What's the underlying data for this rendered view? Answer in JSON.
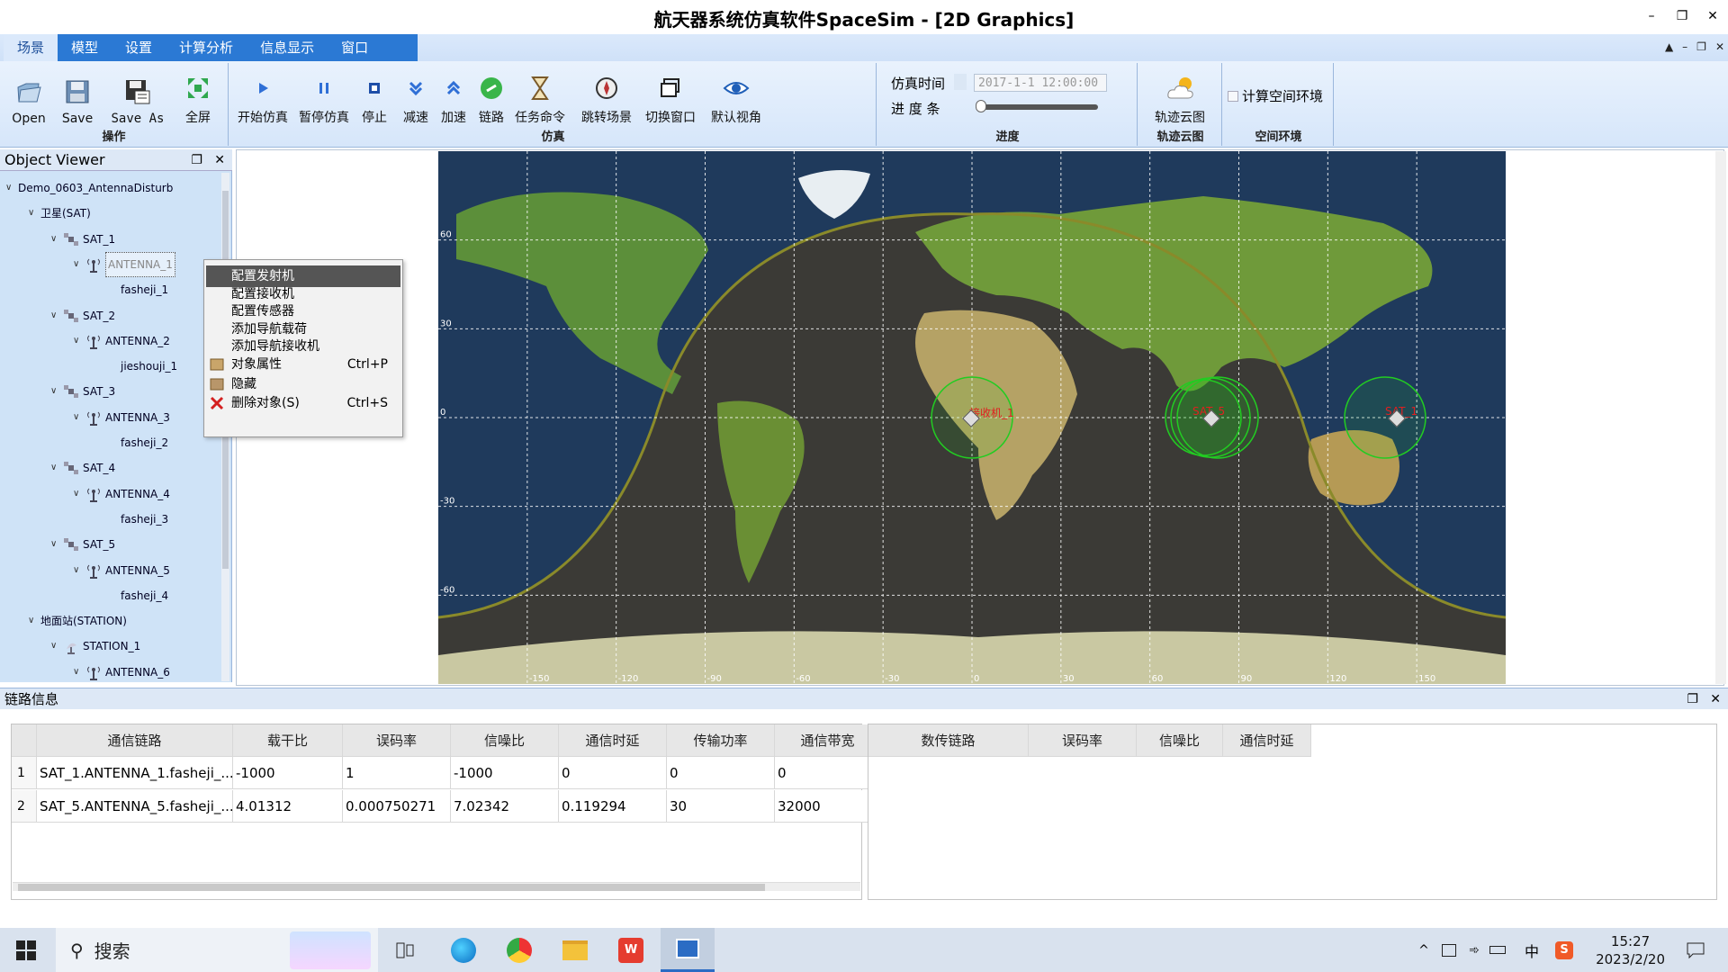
{
  "window": {
    "title": "航天器系统仿真软件SpaceSim - [2D Graphics]"
  },
  "menu_tabs": [
    "场景",
    "模型",
    "设置",
    "计算分析",
    "信息显示",
    "窗口"
  ],
  "ribbon": {
    "ops": {
      "label": "操作",
      "buttons": [
        "Open",
        "Save",
        "Save As",
        "全屏"
      ]
    },
    "sim": {
      "label": "仿真",
      "buttons": [
        "开始仿真",
        "暂停仿真",
        "停止",
        "减速",
        "加速",
        "链路",
        "任务命令",
        "跳转场景",
        "切换窗口",
        "默认视角"
      ]
    },
    "progress": {
      "label": "进度",
      "time_label": "仿真时间",
      "progress_label": "进 度 条",
      "time_value": "2017-1-1 12:00:00",
      "progress_fraction": 0.0
    },
    "cloud": {
      "label": "轨迹云图",
      "button": "轨迹云图"
    },
    "space": {
      "label": "空间环境",
      "checkbox": "计算空间环境",
      "checked": false
    }
  },
  "object_viewer": {
    "title": "Object Viewer",
    "rows": [
      {
        "label": "Demo_0603_AntennaDisturb",
        "type": "scenario"
      },
      {
        "label": "卫星(SAT)",
        "type": "folder"
      },
      {
        "label": "SAT_1",
        "type": "sat"
      },
      {
        "label": "ANTENNA_1",
        "type": "antenna",
        "selected": true
      },
      {
        "label": "fasheji_1",
        "type": "leaf"
      },
      {
        "label": "SAT_2",
        "type": "sat"
      },
      {
        "label": "ANTENNA_2",
        "type": "antenna"
      },
      {
        "label": "jieshouji_1",
        "type": "leaf"
      },
      {
        "label": "SAT_3",
        "type": "sat"
      },
      {
        "label": "ANTENNA_3",
        "type": "antenna"
      },
      {
        "label": "fasheji_2",
        "type": "leaf"
      },
      {
        "label": "SAT_4",
        "type": "sat"
      },
      {
        "label": "ANTENNA_4",
        "type": "antenna"
      },
      {
        "label": "fasheji_3",
        "type": "leaf"
      },
      {
        "label": "SAT_5",
        "type": "sat"
      },
      {
        "label": "ANTENNA_5",
        "type": "antenna"
      },
      {
        "label": "fasheji_4",
        "type": "leaf"
      },
      {
        "label": "地面站(STATION)",
        "type": "folder"
      },
      {
        "label": "STATION_1",
        "type": "station"
      },
      {
        "label": "ANTENNA_6",
        "type": "antenna"
      }
    ]
  },
  "context_menu": [
    {
      "label": "配置发射机",
      "shortcut": "",
      "icon": "",
      "highlighted": true
    },
    {
      "label": "配置接收机",
      "shortcut": "",
      "icon": ""
    },
    {
      "label": "配置传感器",
      "shortcut": "",
      "icon": ""
    },
    {
      "label": "添加导航载荷",
      "shortcut": "",
      "icon": ""
    },
    {
      "label": "添加导航接收机",
      "shortcut": "",
      "icon": ""
    },
    {
      "label": "对象属性",
      "shortcut": "Ctrl+P",
      "icon": "properties-icon"
    },
    {
      "label": "隐藏",
      "shortcut": "",
      "icon": "hide-icon"
    },
    {
      "label": "删除对象(S)",
      "shortcut": "Ctrl+S",
      "icon": "delete-icon"
    }
  ],
  "map": {
    "lat_labels": [
      "60",
      "30",
      "0",
      "-30",
      "-60"
    ],
    "lon_labels": [
      "-150",
      "-120",
      "-90",
      "-60",
      "-30",
      "0",
      "30",
      "60",
      "90",
      "120",
      "150"
    ],
    "sat_labels": [
      "接收机_1",
      "SAT_5",
      "SAT_1"
    ],
    "label_color": "#e02020",
    "coverage_color": "#22cc22"
  },
  "link_panel": {
    "title": "链路信息",
    "comm_table": {
      "headers": [
        "通信链路",
        "载干比",
        "误码率",
        "信噪比",
        "通信时延",
        "传输功率",
        "通信带宽"
      ],
      "rows": [
        [
          "1",
          "SAT_1.ANTENNA_1.fasheji_...",
          "-1000",
          "1",
          "-1000",
          "0",
          "0",
          "0"
        ],
        [
          "2",
          "SAT_5.ANTENNA_5.fasheji_...",
          "4.01312",
          "0.000750271",
          "7.02342",
          "0.119294",
          "30",
          "32000"
        ]
      ]
    },
    "data_table": {
      "headers": [
        "数传链路",
        "误码率",
        "信噪比",
        "通信时延"
      ]
    }
  },
  "taskbar": {
    "search_placeholder": "搜索",
    "time": "15:27",
    "date": "2023/2/20",
    "ime": "中"
  }
}
